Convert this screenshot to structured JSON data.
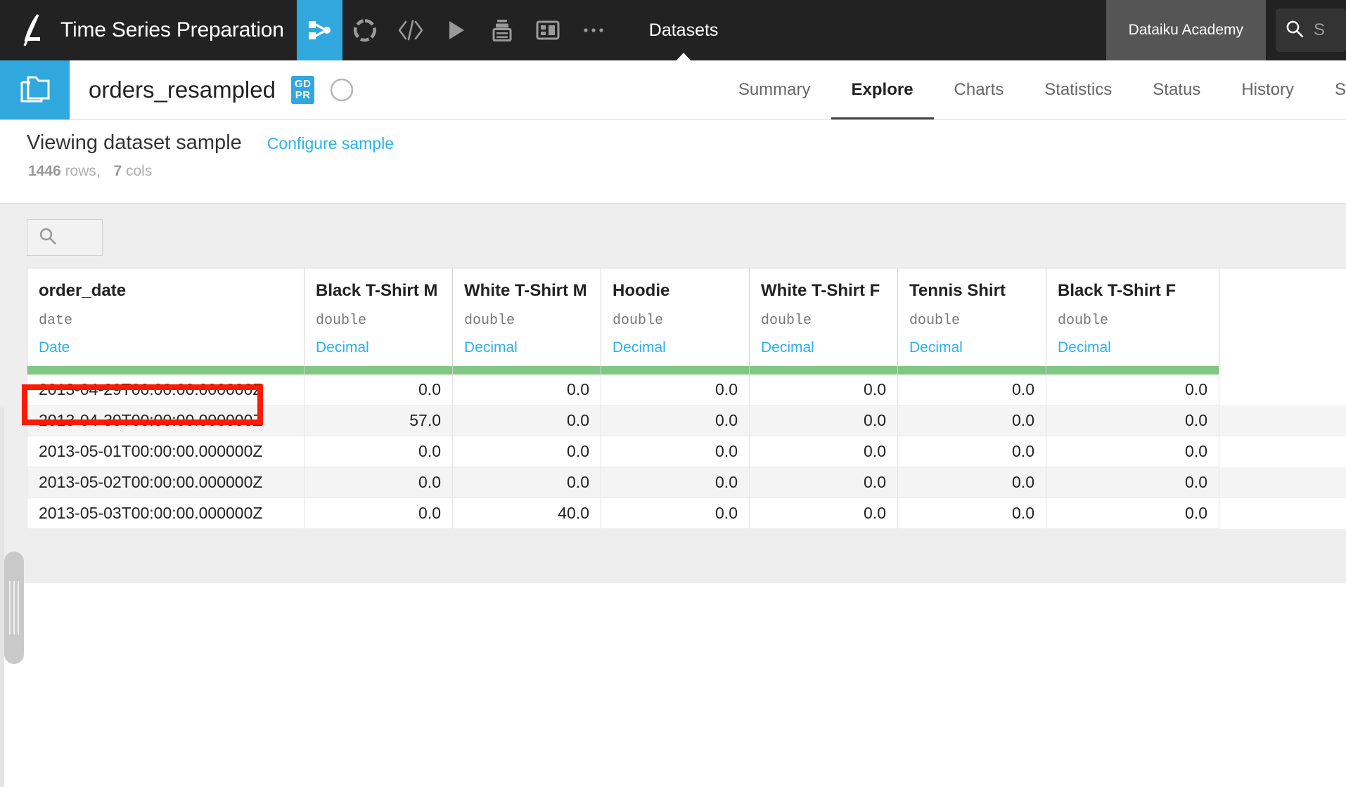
{
  "topbar": {
    "logo_icon": "dataiku-logo-icon",
    "project_title": "Time Series Preparation",
    "icons": [
      {
        "name": "flow-icon",
        "active": true
      },
      {
        "name": "dashboard-circle-icon",
        "active": false
      },
      {
        "name": "code-icon",
        "active": false
      },
      {
        "name": "play-icon",
        "active": false
      },
      {
        "name": "jobs-icon",
        "active": false
      },
      {
        "name": "dashboards-icon",
        "active": false
      },
      {
        "name": "more-ellipsis-icon",
        "active": false
      }
    ],
    "datasets_tab": "Datasets",
    "academy_button": "Dataiku Academy",
    "search_label": "S",
    "search_icon": "search-icon"
  },
  "dataset_header": {
    "folder_icon": "dataset-folder-icon",
    "name": "orders_resampled",
    "gdpr_badge_line1": "GD",
    "gdpr_badge_line2": "PR",
    "compass_icon": "compass-icon",
    "tabs": [
      {
        "label": "Summary",
        "active": false
      },
      {
        "label": "Explore",
        "active": true
      },
      {
        "label": "Charts",
        "active": false
      },
      {
        "label": "Statistics",
        "active": false
      },
      {
        "label": "Status",
        "active": false
      },
      {
        "label": "History",
        "active": false
      },
      {
        "label": "S",
        "active": false
      }
    ]
  },
  "sample_bar": {
    "title": "Viewing dataset sample",
    "configure_link": "Configure sample",
    "row_count": "1446",
    "rows_label": "rows,",
    "col_count": "7",
    "cols_label": "cols"
  },
  "grid": {
    "search_icon": "search-icon",
    "search_value": "",
    "search_placeholder": "",
    "columns": [
      {
        "name": "order_date",
        "type": "date",
        "meaning": "Date"
      },
      {
        "name": "Black T-Shirt M",
        "type": "double",
        "meaning": "Decimal"
      },
      {
        "name": "White T-Shirt M",
        "type": "double",
        "meaning": "Decimal"
      },
      {
        "name": "Hoodie",
        "type": "double",
        "meaning": "Decimal"
      },
      {
        "name": "White T-Shirt F",
        "type": "double",
        "meaning": "Decimal"
      },
      {
        "name": "Tennis Shirt",
        "type": "double",
        "meaning": "Decimal"
      },
      {
        "name": "Black T-Shirt F",
        "type": "double",
        "meaning": "Decimal"
      }
    ],
    "rows": [
      [
        "2013-04-29T00:00:00.000000Z",
        "0.0",
        "0.0",
        "0.0",
        "0.0",
        "0.0",
        "0.0"
      ],
      [
        "2013-04-30T00:00:00.000000Z",
        "57.0",
        "0.0",
        "0.0",
        "0.0",
        "0.0",
        "0.0"
      ],
      [
        "2013-05-01T00:00:00.000000Z",
        "0.0",
        "0.0",
        "0.0",
        "0.0",
        "0.0",
        "0.0"
      ],
      [
        "2013-05-02T00:00:00.000000Z",
        "0.0",
        "0.0",
        "0.0",
        "0.0",
        "0.0",
        "0.0"
      ],
      [
        "2013-05-03T00:00:00.000000Z",
        "0.0",
        "40.0",
        "0.0",
        "0.0",
        "0.0",
        "0.0"
      ]
    ]
  },
  "annotation": {
    "highlight_color": "#fc1a00",
    "target": "first-order-date-cell"
  },
  "colors": {
    "accent_blue": "#31a8dd",
    "link_blue": "#2ab1e8",
    "topbar_dark": "#222222",
    "quality_green": "#80c784"
  }
}
